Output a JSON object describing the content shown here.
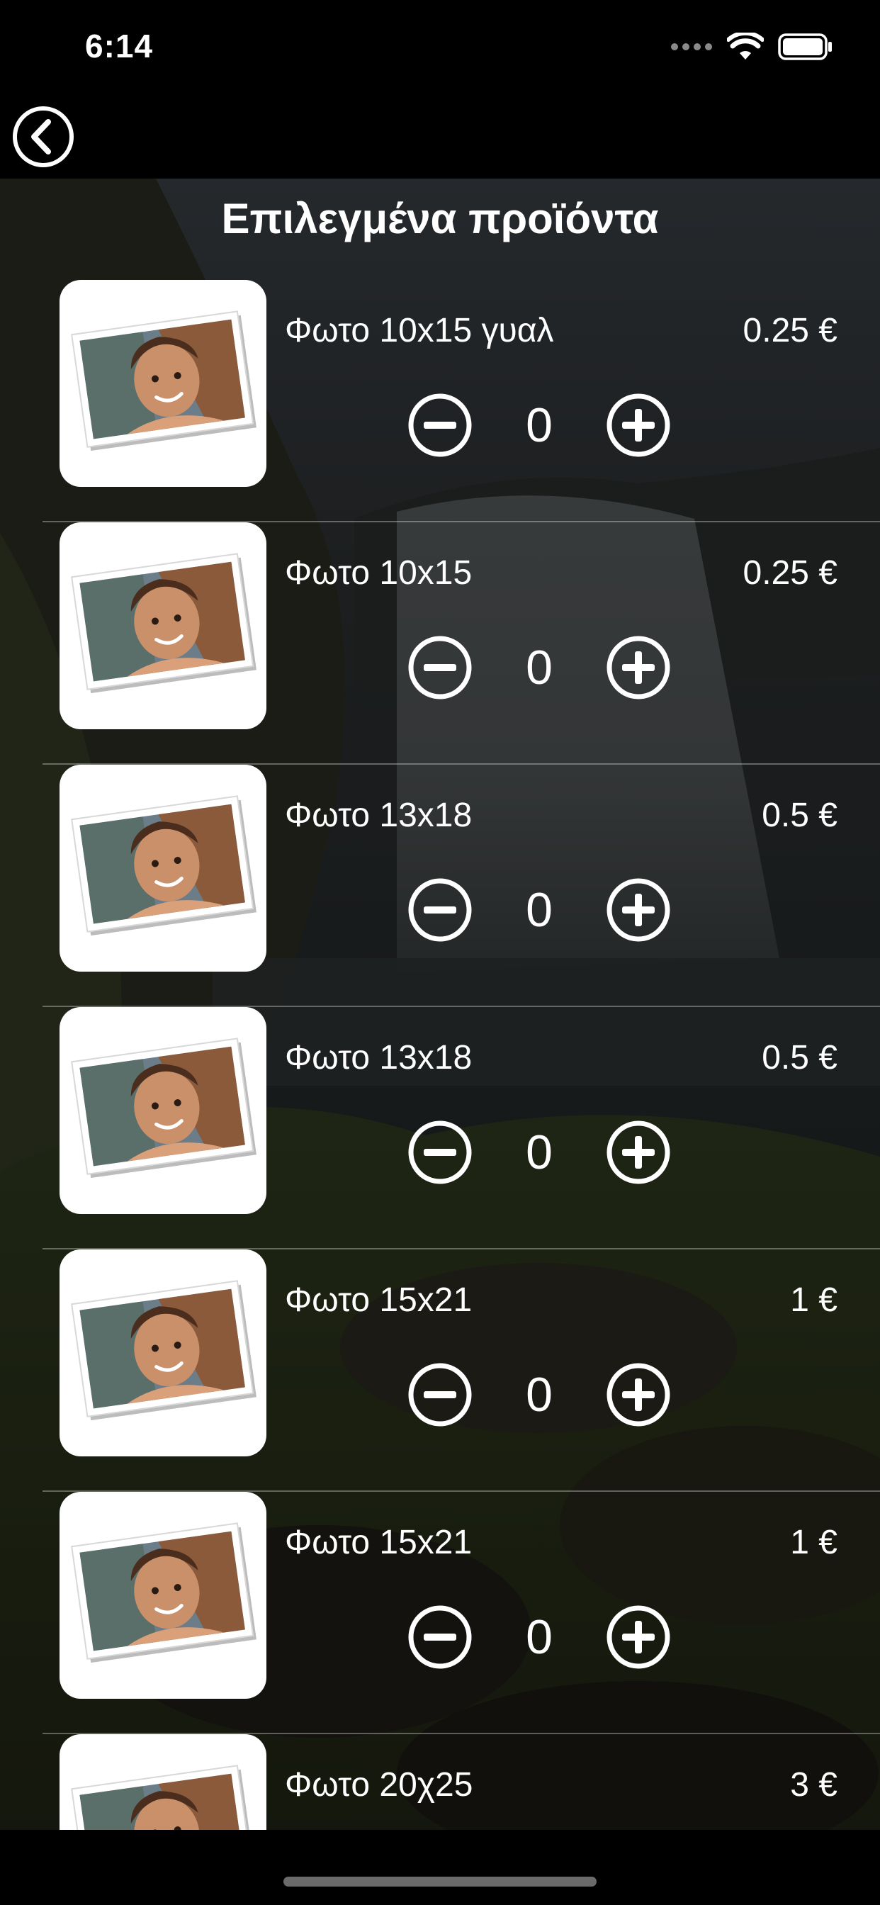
{
  "status_bar": {
    "time": "6:14"
  },
  "nav": {
    "back_icon": "chevron-left-circle-icon"
  },
  "page": {
    "title": "Επιλεγμένα προϊόντα"
  },
  "products": [
    {
      "name": "Φωτο 10x15 γυαλ",
      "price": "0.25 €",
      "quantity": "0"
    },
    {
      "name": "Φωτο 10x15",
      "price": "0.25 €",
      "quantity": "0"
    },
    {
      "name": "Φωτο 13x18",
      "price": "0.5 €",
      "quantity": "0"
    },
    {
      "name": "Φωτο 13x18",
      "price": "0.5 €",
      "quantity": "0"
    },
    {
      "name": "Φωτο 15x21",
      "price": "1 €",
      "quantity": "0"
    },
    {
      "name": "Φωτο 15x21",
      "price": "1 €",
      "quantity": "0"
    },
    {
      "name": "Φωτο 20χ25",
      "price": "3 €",
      "quantity": ""
    }
  ],
  "icons": {
    "minus": "minus-circle-icon",
    "plus": "plus-circle-icon",
    "thumbnail": "photo-print-thumbnail"
  },
  "colors": {
    "background": "#000000",
    "text": "#ffffff",
    "divider": "#7a7a7a"
  }
}
